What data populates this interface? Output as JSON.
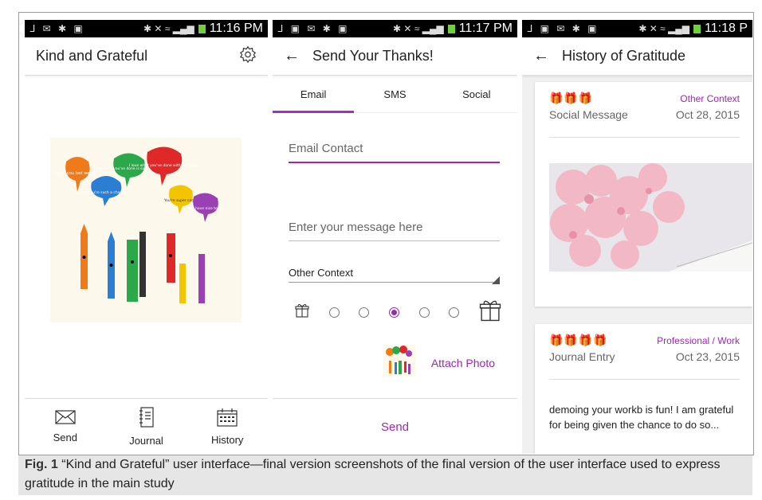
{
  "screens": [
    {
      "status": {
        "left_icons": "ᒧ ✉ ✱ ▣",
        "right_icons": "✱ ✕ ≈ ▂▄▆",
        "time": "11:16 PM"
      },
      "title": "Kind and Grateful",
      "illustration_texts": [
        "Have you lost weight?",
        "Oh you're such a charmer!",
        "The work you've done is so inspiring",
        "I love what you've done with your hair!",
        "You're super cool!",
        "You have nice teeth"
      ],
      "nav": [
        {
          "label": "Send",
          "icon": "envelope-icon"
        },
        {
          "label": "Journal",
          "icon": "journal-icon"
        },
        {
          "label": "History",
          "icon": "calendar-icon"
        }
      ]
    },
    {
      "status": {
        "left_icons": "ᒧ ▣ ✉ ✱ ▣",
        "right_icons": "✱ ✕ ≈ ▂▄▆",
        "time": "11:17 PM"
      },
      "title": "Send Your Thanks!",
      "tabs": [
        "Email",
        "SMS",
        "Social"
      ],
      "active_tab": 0,
      "email_placeholder": "Email Contact",
      "message_placeholder": "Enter your message here",
      "context_value": "Other Context",
      "rating_selected": 3,
      "rating_count": 5,
      "attach_label": "Attach Photo",
      "send_label": "Send"
    },
    {
      "status": {
        "left_icons": "ᒧ ▣ ✉ ✱ ▣",
        "right_icons": "✱ ✕ ≈ ▂▄▆",
        "time": "11:18 P"
      },
      "title": "History of Gratitude",
      "entries": [
        {
          "gifts": "🎁🎁🎁",
          "context": "Other Context",
          "type": "Social Message",
          "date": "Oct 28, 2015"
        },
        {
          "gifts": "🎁🎁🎁🎁",
          "context": "Professional / Work",
          "type": "Journal Entry",
          "date": "Oct 23, 2015",
          "text": "demoing your workb is fun! I am grateful for being given the chance to do so..."
        }
      ]
    }
  ],
  "caption": {
    "label": "Fig. 1",
    "text": "“Kind and Grateful” user interface—final version screenshots of the final version of the user interface used to express gratitude in the main study"
  },
  "colors": {
    "accent": "#9c27b0",
    "statusbar": "#000000",
    "battery": "#6dd23a"
  }
}
